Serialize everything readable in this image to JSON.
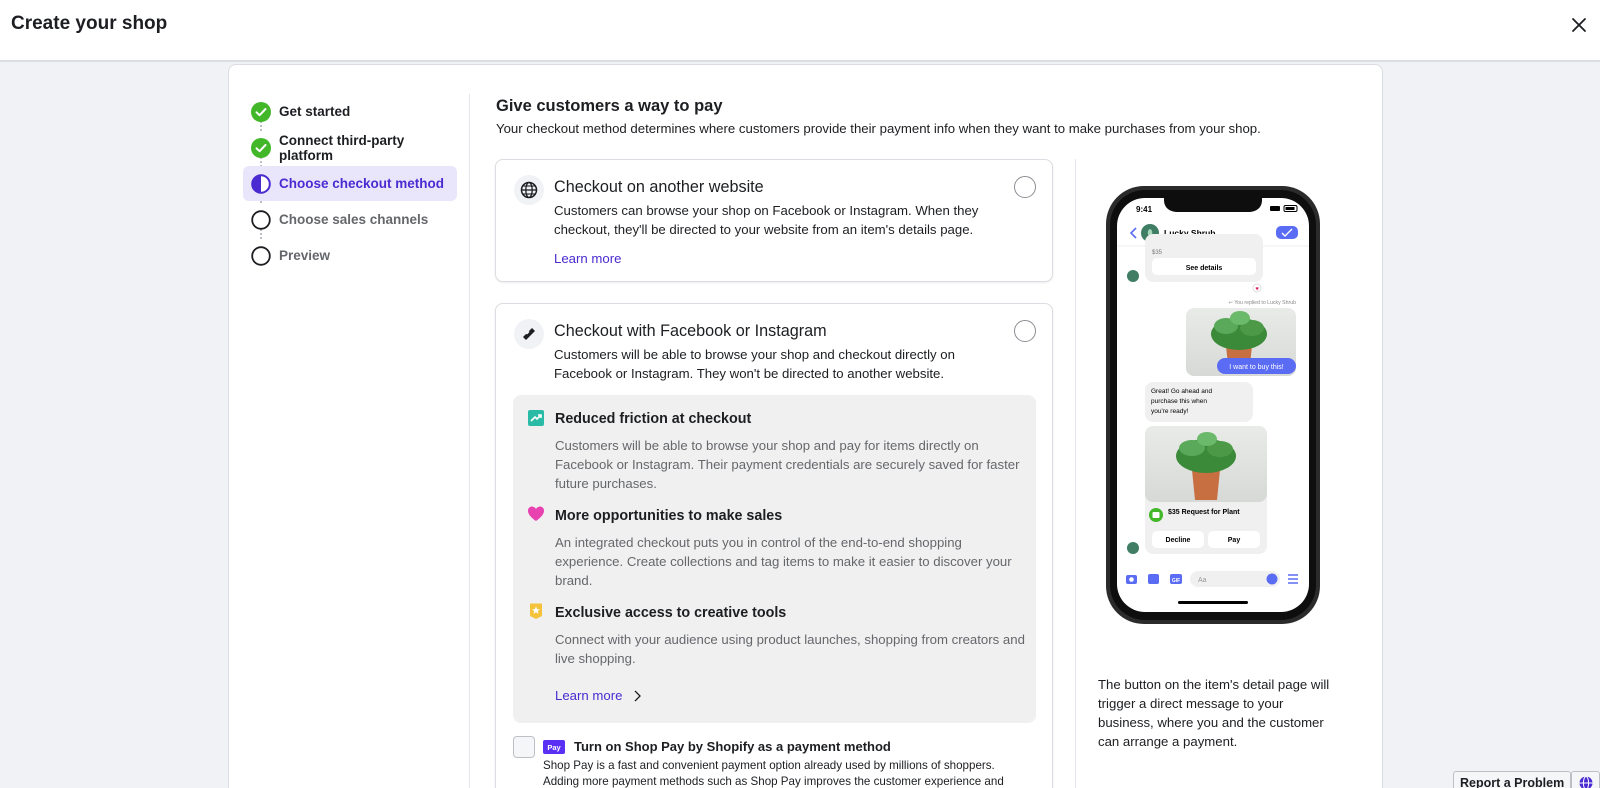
{
  "header": {
    "title": "Create your shop"
  },
  "steps": [
    {
      "label": "Get started",
      "state": "done"
    },
    {
      "label": "Connect third-party platform",
      "state": "done"
    },
    {
      "label": "Choose checkout method",
      "state": "active"
    },
    {
      "label": "Choose sales channels",
      "state": "todo"
    },
    {
      "label": "Preview",
      "state": "todo"
    }
  ],
  "main": {
    "heading": "Give customers a way to pay",
    "subheading": "Your checkout method determines where customers provide their payment info when they want to make purchases from your shop.",
    "option_website": {
      "title": "Checkout on another website",
      "desc": "Customers can browse your shop on Facebook or Instagram. When they checkout, they'll be directed to your website from an item's details page.",
      "link": "Learn more"
    },
    "option_fb": {
      "title": "Checkout with Facebook or Instagram",
      "desc": "Customers will be able to browse your shop and checkout directly on Facebook or Instagram. They won't be directed to another website.",
      "benefits": [
        {
          "title": "Reduced friction at checkout",
          "desc": "Customers will be able to browse your shop and pay for items directly on Facebook or Instagram. Their payment credentials are securely saved for faster future purchases.",
          "icon": "trend-icon"
        },
        {
          "title": "More opportunities to make sales",
          "desc": "An integrated checkout puts you in control of the end-to-end shopping experience. Create collections and tag items to make it easier to discover your brand.",
          "icon": "heart-icon"
        },
        {
          "title": "Exclusive access to creative tools",
          "desc": "Connect with your audience using product launches, shopping from creators and live shopping.",
          "icon": "badge-icon"
        }
      ],
      "benefits_link": "Learn more",
      "shoppay": {
        "logo": "Pay",
        "title": "Turn on Shop Pay by Shopify as a payment method",
        "desc": "Shop Pay is a fast and convenient payment option already used by millions of shoppers. Adding more payment methods such as Shop Pay improves the customer experience and can increase"
      }
    }
  },
  "preview": {
    "phone": {
      "time": "9:41",
      "contact": "Lucky Shrub",
      "price_small": "$35",
      "see_details": "See details",
      "replied": "You replied to Lucky Shrub",
      "user_msg": "I want to buy this!",
      "bot_msg": "Great! Go ahead and purchase this when you're ready!",
      "request": "$35 Request for Plant",
      "decline": "Decline",
      "pay": "Pay",
      "composer_placeholder": "Aa"
    },
    "caption": "The button on the item's detail page will trigger a direct message to your business, where you and the customer can arrange a payment."
  },
  "footer": {
    "report": "Report a Problem"
  },
  "colors": {
    "accent": "#4a2bd1",
    "success": "#42b72a",
    "messenger_blue": "#5b6cf4"
  }
}
